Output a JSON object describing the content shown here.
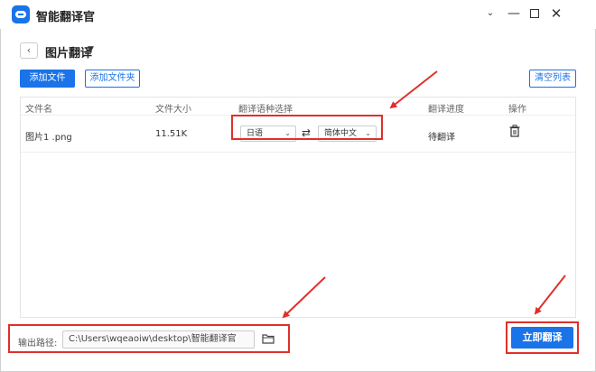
{
  "window": {
    "title": "智能翻译官",
    "controls": {
      "collapse": "⌄",
      "minimize": "—",
      "close": "✕"
    }
  },
  "header": {
    "back": "‹",
    "title": "图片翻译",
    "caret": "▼"
  },
  "toolbar": {
    "add_file": "添加文件",
    "add_folder": "添加文件夹",
    "clear_list": "清空列表"
  },
  "table": {
    "columns": [
      "文件名",
      "文件大小",
      "翻译语种选择",
      "翻译进度",
      "操作"
    ],
    "rows": [
      {
        "filename": "图片1 .png",
        "size": "11.51K",
        "source_lang": "日语",
        "target_lang": "简体中文",
        "progress": "待翻译"
      }
    ]
  },
  "footer": {
    "output_label": "输出路径:",
    "output_path": "C:\\Users\\wqeaoiw\\desktop\\智能翻译官",
    "translate_button": "立即翻译"
  },
  "icons": {
    "swap": "⇄",
    "accent": "#1a73e8",
    "highlight": "#e0302a"
  }
}
